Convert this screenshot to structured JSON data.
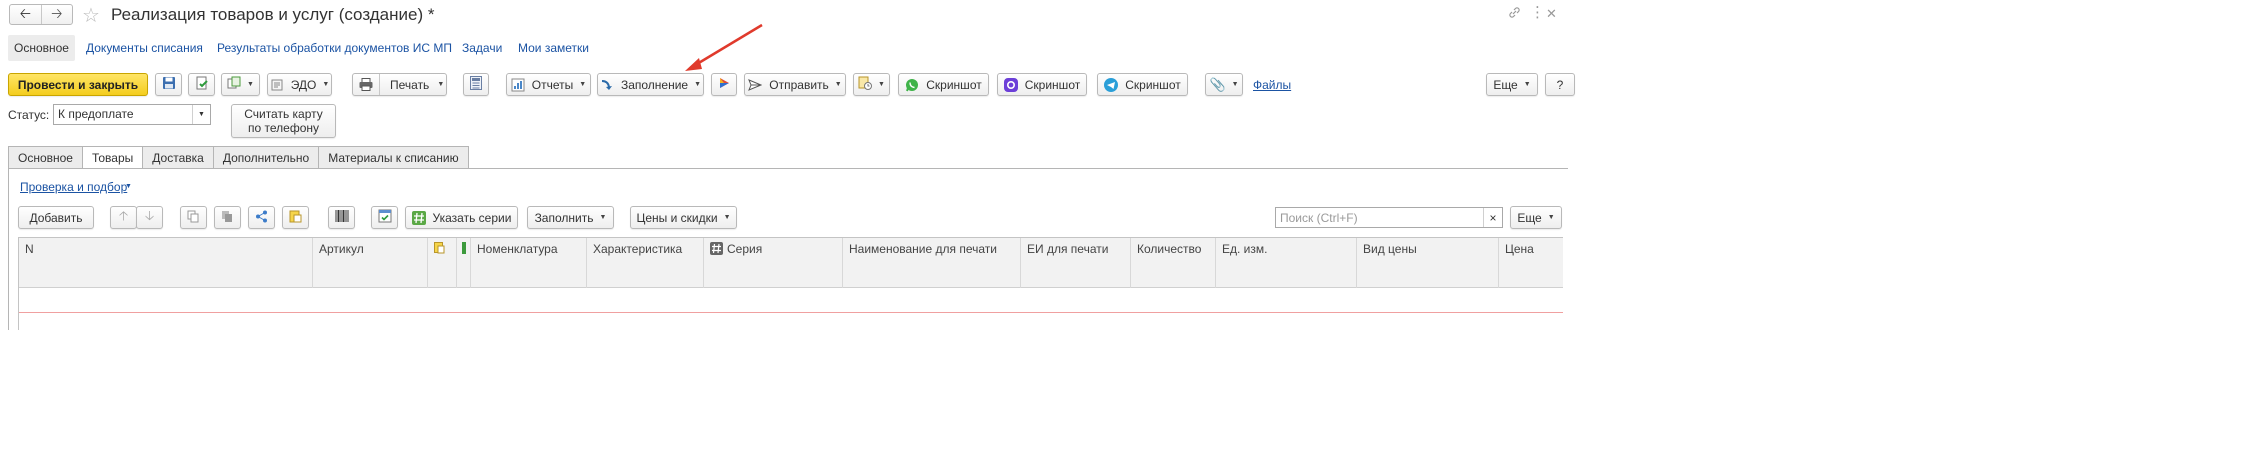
{
  "window": {
    "title": "Реализация товаров и услуг (создание) *",
    "back_icon": "arrow-left-icon",
    "forward_icon": "arrow-right-icon",
    "favorite_icon": "star-icon"
  },
  "topnav": {
    "items": [
      "Основное",
      "Документы списания",
      "Результаты обработки документов ИС МП",
      "Задачи",
      "Мои заметки"
    ]
  },
  "toolbar": {
    "post_close": "Провести и закрыть",
    "edo": "ЭДО",
    "print": "Печать",
    "reports": "Отчеты",
    "fill": "Заполнение",
    "send": "Отправить",
    "screenshot": "Скриншот",
    "files": "Файлы",
    "more": "Еще",
    "help": "?"
  },
  "status": {
    "label": "Статус:",
    "value": "К предоплате",
    "card_button": "Считать карту по телефону"
  },
  "tabs": [
    "Основное",
    "Товары",
    "Доставка",
    "Дополнительно",
    "Материалы к списанию"
  ],
  "active_tab": "Товары",
  "goods": {
    "check_link": "Проверка и подбор",
    "add": "Добавить",
    "series": "Указать серии",
    "fill": "Заполнить",
    "prices": "Цены и скидки",
    "search_placeholder": "Поиск (Ctrl+F)",
    "search_clear": "×",
    "more": "Еще",
    "columns": [
      "N",
      "Артикул",
      "Номенклатура",
      "Характеристика",
      "Серия",
      "Наименование для печати",
      "ЕИ для печати",
      "Количество",
      "Ед. изм.",
      "Вид цены",
      "Цена"
    ]
  },
  "colors": {
    "accent_yellow": "#f4cd1e",
    "link_blue": "#1b53a3",
    "annotation_red": "#e03a2c",
    "whatsapp_green": "#3fb349",
    "max_purple": "#6c3fd8",
    "telegram_blue": "#2a9fd8"
  }
}
